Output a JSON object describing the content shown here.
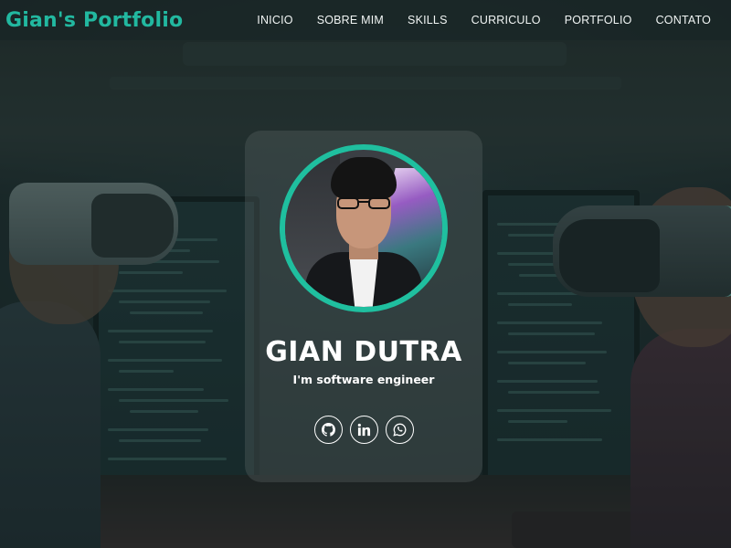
{
  "brand": {
    "name": "Gian's Portfolio",
    "color": "#22b8a0"
  },
  "nav": {
    "items": [
      {
        "label": "INICIO"
      },
      {
        "label": "SOBRE MIM"
      },
      {
        "label": "SKILLS"
      },
      {
        "label": "CURRICULO"
      },
      {
        "label": "PORTFOLIO"
      },
      {
        "label": "CONTATO"
      }
    ]
  },
  "hero": {
    "name": "GIAN DUTRA",
    "subtitle": "I'm software engineer",
    "accent_color": "#1fbf9f",
    "avatar_icon": "profile-photo",
    "socials": [
      {
        "icon": "github-icon"
      },
      {
        "icon": "linkedin-icon"
      },
      {
        "icon": "whatsapp-icon"
      }
    ]
  }
}
